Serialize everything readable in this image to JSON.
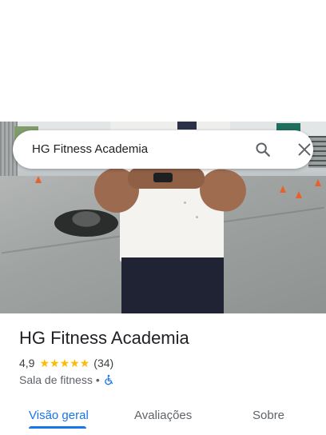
{
  "search": {
    "query": "HG Fitness Academia",
    "search_icon": "search-icon",
    "close_icon": "close-icon"
  },
  "place": {
    "name": "HG Fitness Academia",
    "rating": "4,9",
    "stars": 5,
    "review_count": "(34)",
    "category": "Sala de fitness",
    "separator": "•",
    "accessibility_icon": "wheelchair-icon"
  },
  "tabs": [
    {
      "label": "Visão geral",
      "active": true
    },
    {
      "label": "Avaliações",
      "active": false
    },
    {
      "label": "Sobre",
      "active": false
    }
  ],
  "colors": {
    "accent": "#1a73e8",
    "star": "#fbbc04",
    "text": "#202124",
    "secondary_text": "#5f6368"
  }
}
